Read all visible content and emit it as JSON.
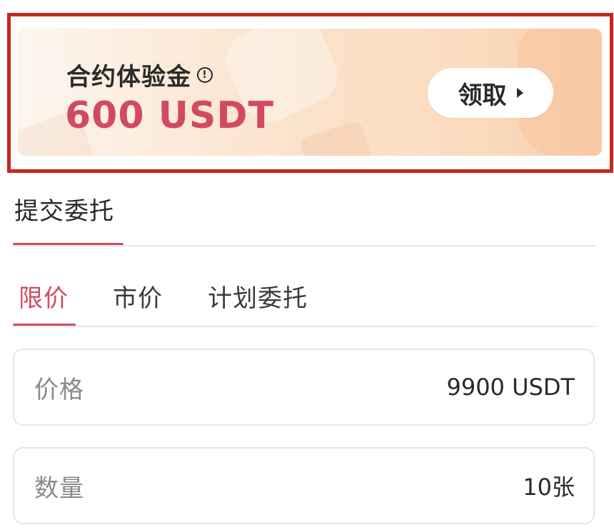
{
  "banner": {
    "title": "合约体验金",
    "amount": "600 USDT",
    "claim_label": "领取",
    "colors": {
      "amount": "#d34a5f",
      "highlight_border": "#c8281e"
    }
  },
  "section": {
    "title": "提交委托"
  },
  "tabs": [
    {
      "label": "限价",
      "active": true
    },
    {
      "label": "市价",
      "active": false
    },
    {
      "label": "计划委托",
      "active": false
    }
  ],
  "fields": {
    "price": {
      "label": "价格",
      "value": "9900 USDT"
    },
    "quantity": {
      "label": "数量",
      "value": "10张"
    }
  },
  "icons": {
    "info": "info-circle-icon",
    "arrow": "caret-right-icon"
  }
}
